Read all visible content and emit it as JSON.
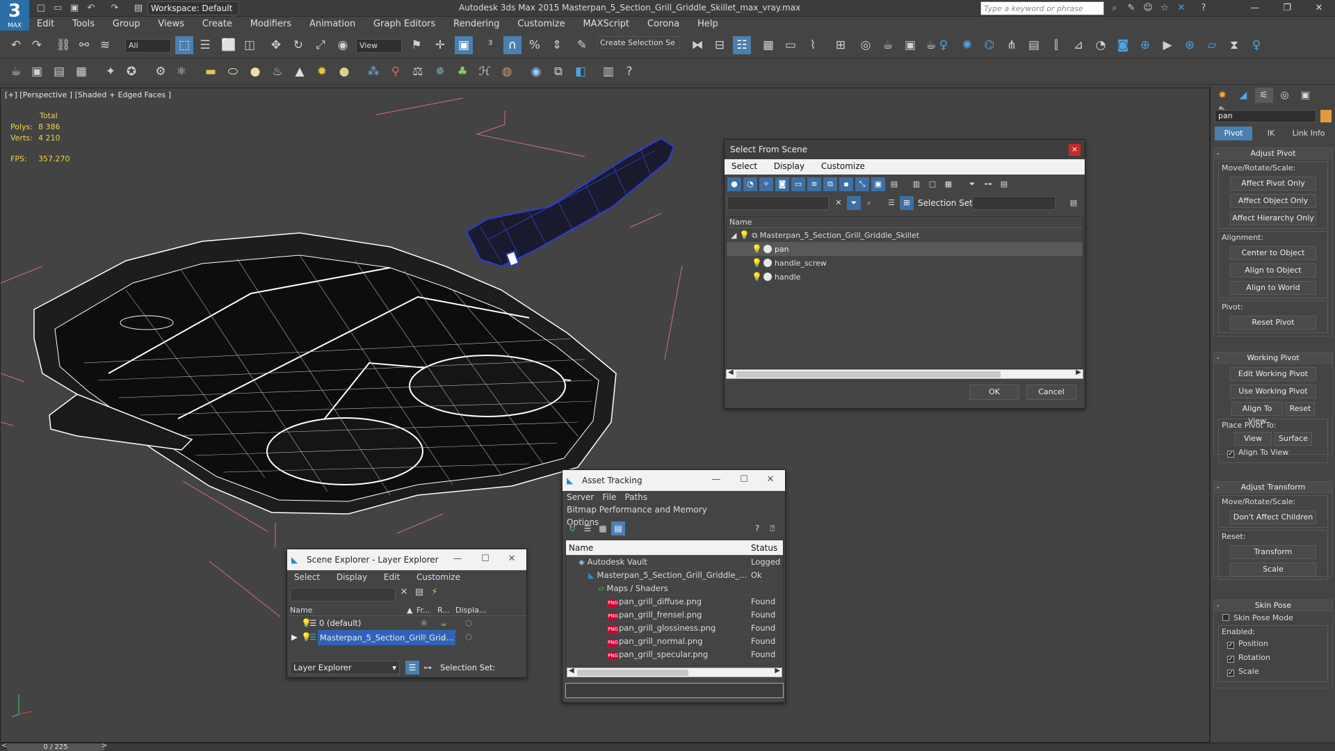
{
  "window": {
    "title": "Autodesk 3ds Max  2015     Masterpan_5_Section_Grill_Griddle_Skillet_max_vray.max",
    "logo": "MAX",
    "workspace": "Workspace: Default",
    "search_placeholder": "Type a keyword or phrase"
  },
  "menu": [
    "Edit",
    "Tools",
    "Group",
    "Views",
    "Create",
    "Modifiers",
    "Animation",
    "Graph Editors",
    "Rendering",
    "Customize",
    "MAXScript",
    "Corona",
    "Help"
  ],
  "toolbar": {
    "selection_filter": "All",
    "ref_coord": "View",
    "named_selection": "Create Selection Se"
  },
  "viewport": {
    "label": "[+] [Perspective ] [Shaded + Edged Faces ]",
    "stats_header": "Total",
    "polys_label": "Polys:",
    "polys_value": "8 386",
    "verts_label": "Verts:",
    "verts_value": "4 210",
    "fps_label": "FPS:",
    "fps_value": "357.270"
  },
  "command_panel": {
    "object_name": "pan",
    "object_color": "#e39a3b",
    "subtabs": [
      "Pivot",
      "IK",
      "Link Info"
    ],
    "adjust_pivot": {
      "title": "Adjust Pivot",
      "move_label": "Move/Rotate/Scale:",
      "buttons": [
        "Affect Pivot Only",
        "Affect Object Only",
        "Affect Hierarchy Only"
      ],
      "alignment_label": "Alignment:",
      "align_buttons": [
        "Center to Object",
        "Align to Object",
        "Align to World"
      ],
      "pivot_label": "Pivot:",
      "reset_pivot": "Reset Pivot"
    },
    "working_pivot": {
      "title": "Working Pivot",
      "edit": "Edit Working Pivot",
      "use": "Use Working Pivot",
      "align_to_view": "Align To View",
      "reset": "Reset",
      "place_label": "Place Pivot To:",
      "view": "View",
      "surface": "Surface",
      "align_to_view_check": "Align To View"
    },
    "adjust_transform": {
      "title": "Adjust Transform",
      "move_label": "Move/Rotate/Scale:",
      "dont_affect": "Don't Affect Children",
      "reset_label": "Reset:",
      "transform": "Transform",
      "scale": "Scale"
    },
    "skin_pose": {
      "title": "Skin Pose",
      "mode": "Skin Pose Mode",
      "enabled_label": "Enabled:",
      "position": "Position",
      "rotation": "Rotation",
      "scale": "Scale"
    }
  },
  "select_from_scene": {
    "title": "Select From Scene",
    "menu": [
      "Select",
      "Display",
      "Customize"
    ],
    "selection_set_label": "Selection Set:",
    "column_name": "Name",
    "root": "Masterpan_5_Section_Grill_Griddle_Skillet",
    "children": [
      "pan",
      "handle_screw",
      "handle"
    ],
    "ok": "OK",
    "cancel": "Cancel"
  },
  "asset_tracking": {
    "title": "Asset Tracking",
    "menu": [
      "Server",
      "File",
      "Paths",
      "Bitmap Performance and Memory",
      "Options"
    ],
    "col_name": "Name",
    "col_status": "Status",
    "rows": [
      {
        "name": "Autodesk Vault",
        "status": "Logged"
      },
      {
        "name": "Masterpan_5_Section_Grill_Griddle_...",
        "status": "Ok"
      },
      {
        "name": "Maps / Shaders",
        "status": ""
      },
      {
        "name": "pan_grill_diffuse.png",
        "status": "Found"
      },
      {
        "name": "pan_grill_frensel.png",
        "status": "Found"
      },
      {
        "name": "pan_grill_glossiness.png",
        "status": "Found"
      },
      {
        "name": "pan_grill_normal.png",
        "status": "Found"
      },
      {
        "name": "pan_grill_specular.png",
        "status": "Found"
      }
    ]
  },
  "scene_explorer": {
    "title": "Scene Explorer - Layer Explorer",
    "menu": [
      "Select",
      "Display",
      "Edit",
      "Customize"
    ],
    "cols": [
      "Name",
      "Fr...",
      "R...",
      "Displa..."
    ],
    "rows": [
      "0 (default)",
      "Masterpan_5_Section_Grill_Grid..."
    ],
    "footer_mode": "Layer Explorer",
    "selection_set_label": "Selection Set:"
  },
  "status": {
    "frame": "0 / 225"
  }
}
